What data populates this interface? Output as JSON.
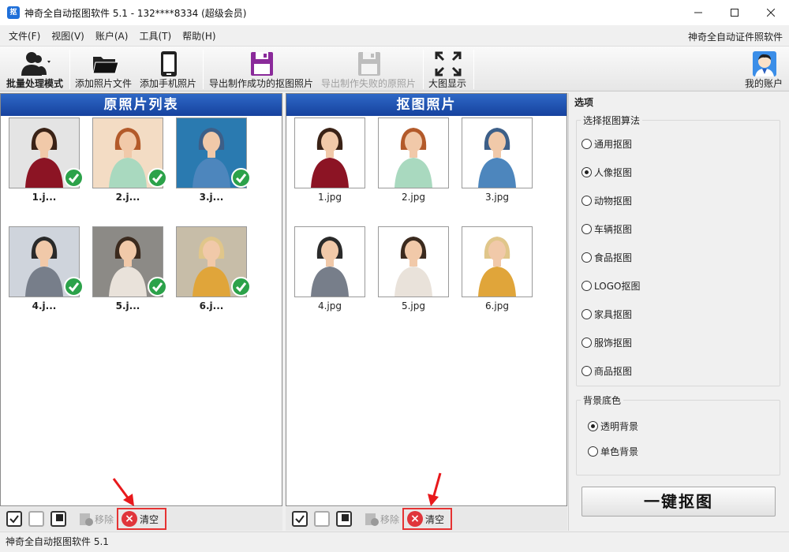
{
  "window": {
    "app_icon_char": "抠",
    "title": "神奇全自动抠图软件 5.1 - 132****8334 (超级会员)"
  },
  "menu": {
    "items": [
      "文件(F)",
      "视图(V)",
      "账户(A)",
      "工具(T)",
      "帮助(H)"
    ],
    "right_link": "神奇全自动证件照软件"
  },
  "toolbar": {
    "batch_mode": "批量处理模式",
    "add_photo_file": "添加照片文件",
    "add_phone_photo": "添加手机照片",
    "export_success": "导出制作成功的抠图照片",
    "export_failed": "导出制作失败的原照片",
    "large_view": "大图显示",
    "my_account": "我的账户"
  },
  "left_panel": {
    "title": "原照片列表",
    "items": [
      "1.j...",
      "2.j...",
      "3.j...",
      "4.j...",
      "5.j...",
      "6.j..."
    ]
  },
  "right_panel": {
    "title": "抠图照片",
    "items": [
      "1.jpg",
      "2.jpg",
      "3.jpg",
      "4.jpg",
      "5.jpg",
      "6.jpg"
    ]
  },
  "bottom_bar": {
    "remove": "移除",
    "clear": "清空"
  },
  "options": {
    "title": "选项",
    "algorithm_group": "选择抠图算法",
    "algorithms": [
      "通用抠图",
      "人像抠图",
      "动物抠图",
      "车辆抠图",
      "食品抠图",
      "LOGO抠图",
      "家具抠图",
      "服饰抠图",
      "商品抠图"
    ],
    "selected_algorithm": "人像抠图",
    "background_group": "背景底色",
    "backgrounds": [
      "透明背景",
      "单色背景"
    ],
    "selected_background": "透明背景",
    "run_button": "一键抠图"
  },
  "status": {
    "text": "神奇全自动抠图软件 5.1"
  },
  "colors": {
    "panel_header": "#2459b8",
    "check_green": "#2ca24a",
    "clear_red": "#e53333",
    "annotation_arrow": "#e8191c"
  }
}
